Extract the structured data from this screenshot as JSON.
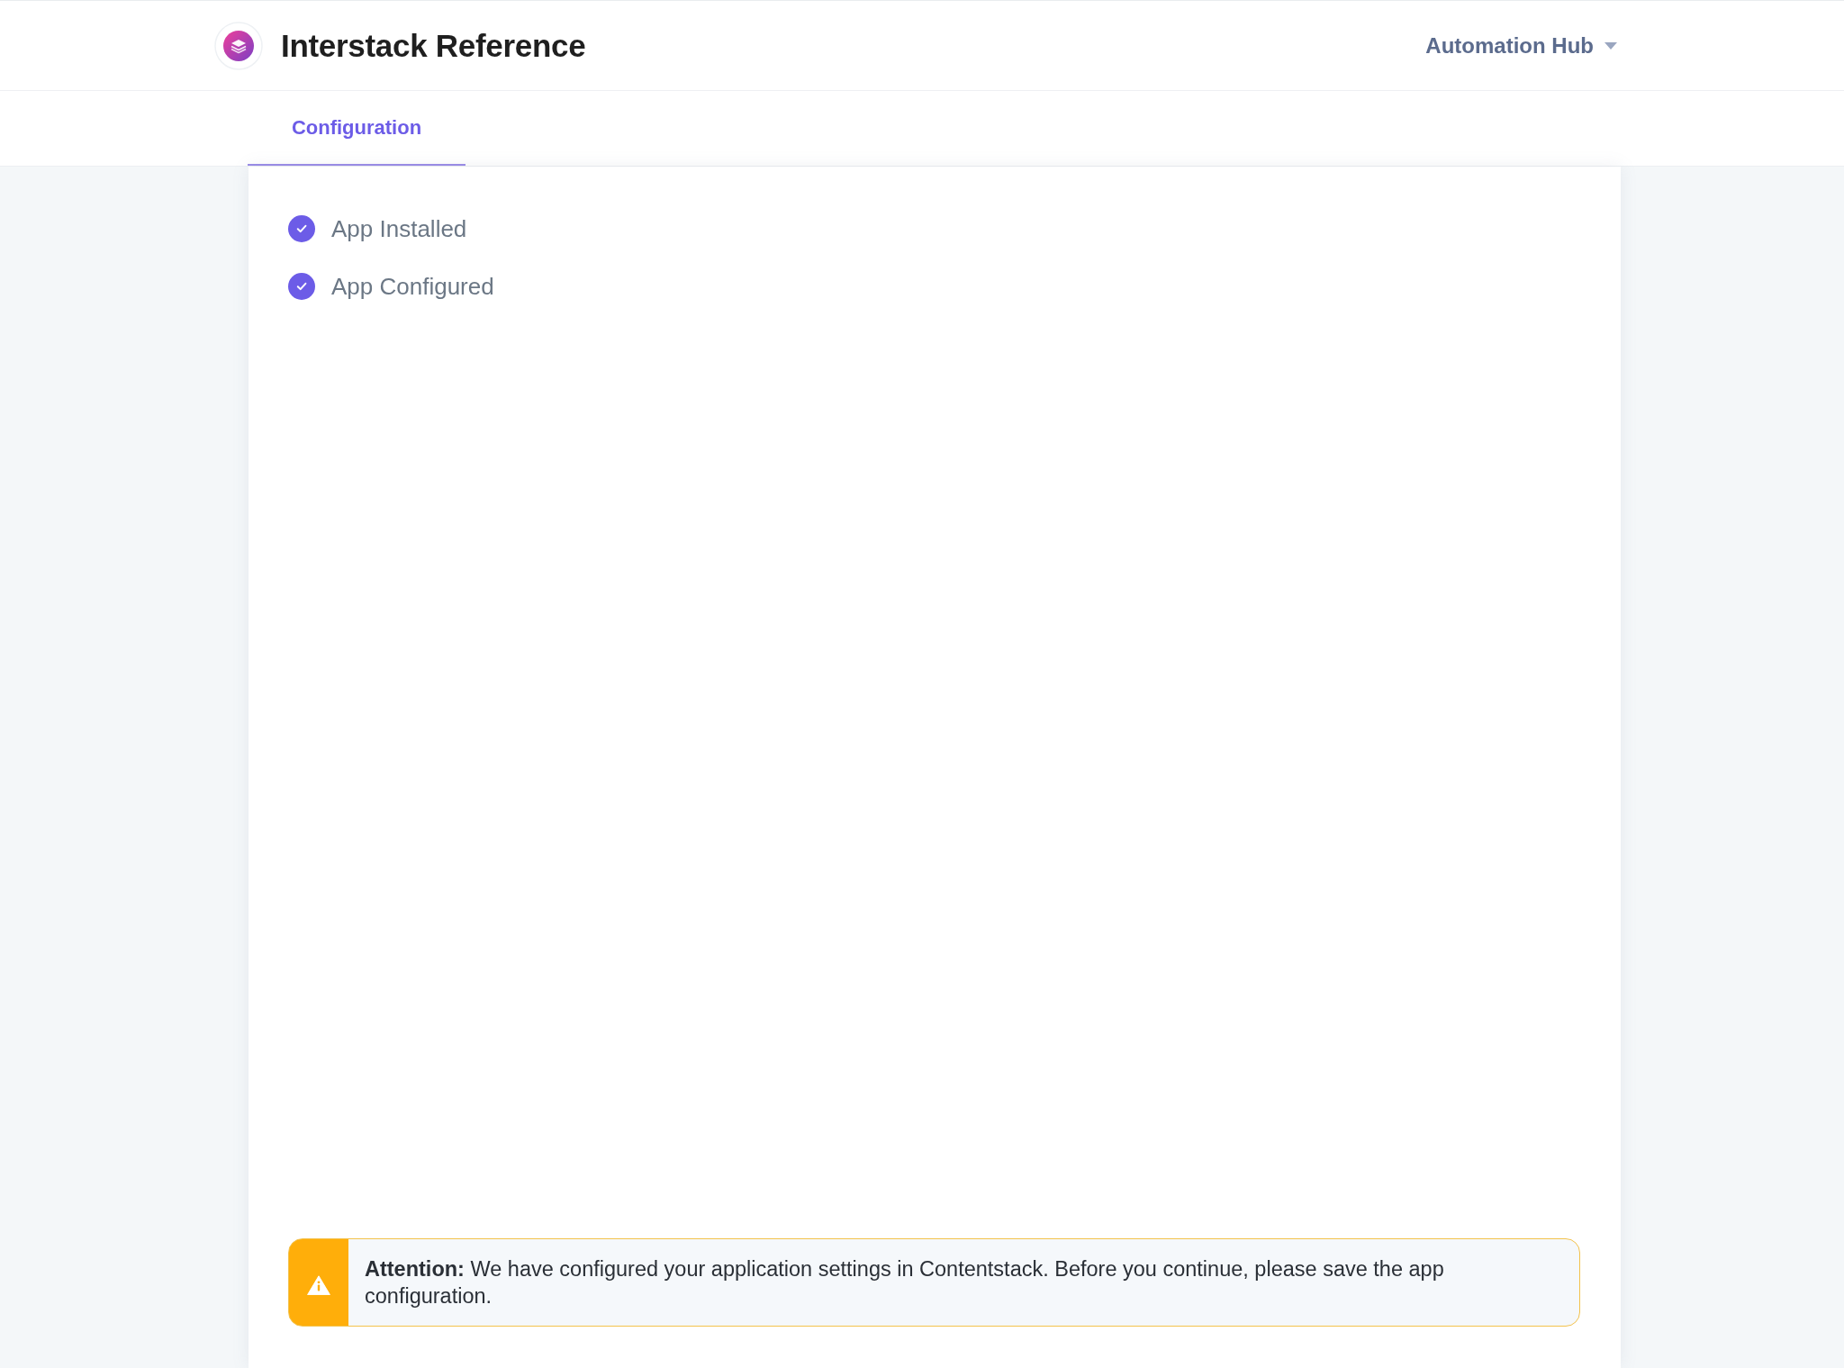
{
  "header": {
    "app_title": "Interstack Reference",
    "org_switcher": {
      "label": "Automation Hub"
    }
  },
  "tabs": [
    {
      "label": "Configuration",
      "selected": true
    }
  ],
  "checklist": [
    {
      "label": "App Installed",
      "checked": true
    },
    {
      "label": "App Configured",
      "checked": true
    }
  ],
  "alert": {
    "kind": "warning",
    "text": "**Attention:** We have configured your application settings in Contentstack. Before you continue, please save the app configuration."
  }
}
